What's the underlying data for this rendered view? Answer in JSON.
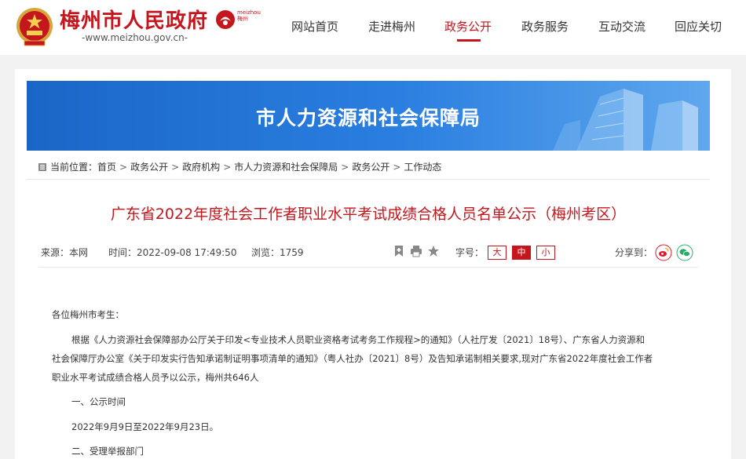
{
  "header": {
    "site_title": "梅州市人民政府",
    "site_url": "-www.meizhou.gov.cn-",
    "sublogo_text": "meizhou\n梅州",
    "nav": [
      {
        "label": "网站首页",
        "active": false
      },
      {
        "label": "走进梅州",
        "active": false
      },
      {
        "label": "政务公开",
        "active": true
      },
      {
        "label": "政务服务",
        "active": false
      },
      {
        "label": "互动交流",
        "active": false
      },
      {
        "label": "回应关切",
        "active": false
      }
    ]
  },
  "banner": {
    "title": "市人力资源和社会保障局"
  },
  "breadcrumb": {
    "prefix": "当前位置：",
    "items": [
      "首页",
      "政务公开",
      "政府机构",
      "市人力资源和社会保障局",
      "政务公开",
      "工作动态"
    ]
  },
  "article": {
    "title": "广东省2022年度社会工作者职业水平考试成绩合格人员名单公示（梅州考区）",
    "source": "来源：本网",
    "time": "时间：2022-09-08 17:49:50",
    "views": "浏览：1759",
    "fontsize_label": "字号：",
    "fontsize_options": [
      "大",
      "中",
      "小"
    ],
    "fontsize_selected": "中",
    "share_label": "分享到：",
    "paragraphs": [
      "各位梅州市考生：",
      "根据《人力资源社会保障部办公厅关于印发<专业技术人员职业资格考试考务工作规程>的通知》（人社厅发〔2021〕18号）、广东省人力资源和",
      "社会保障厅办公室《关于印发实行告知承诺制证明事项清单的通知》（粤人社办〔2021〕8号）及告知承诺制相关要求,现对广东省2022年度社会工作者",
      "职业水平考试成绩合格人员予以公示，梅州共646人",
      "一、公示时间",
      "2022年9月9日至2022年9月23日。",
      "二、受理举报部门"
    ]
  },
  "colors": {
    "accent": "#c5161d",
    "banner": "#2a7fe0"
  }
}
